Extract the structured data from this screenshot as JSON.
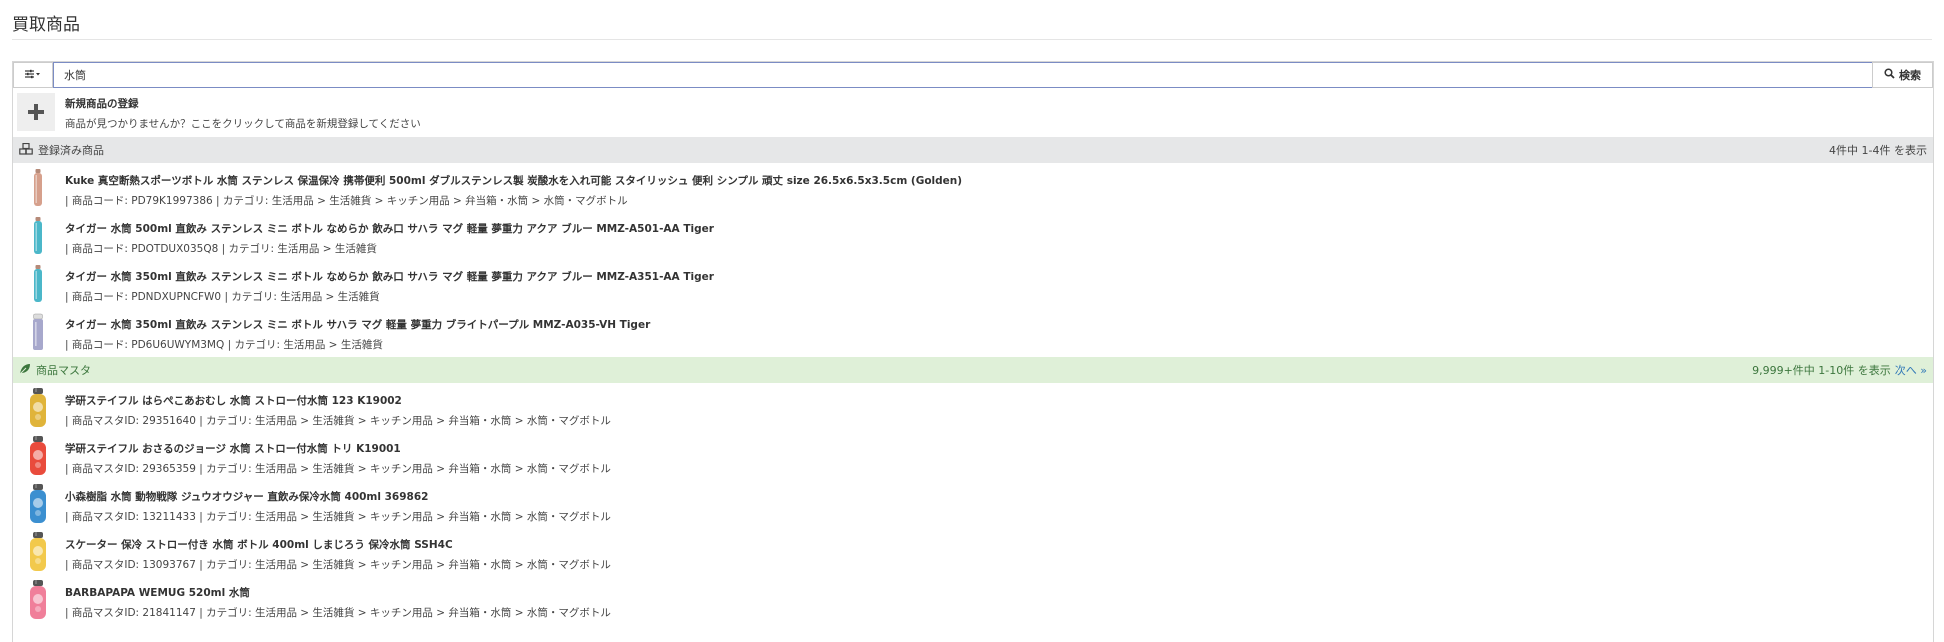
{
  "page": {
    "title": "買取商品"
  },
  "search": {
    "value": "水筒",
    "button_label": "検索"
  },
  "new_product": {
    "title": "新規商品の登録",
    "subtitle": "商品が見つかりませんか？ここをクリックして商品を新規登録してください"
  },
  "registered": {
    "label": "登録済み商品",
    "count_text": "4件中 1-4件 を表示",
    "items": [
      {
        "title": "Kuke 真空断熱スポーツボトル 水筒 ステンレス 保温保冷 携帯便利 500ml ダブルステンレス製 炭酸水を入れ可能 スタイリッシュ 便利 シンプル 頑丈 size 26.5x6.5x3.5cm (Golden)",
        "sub": "| 商品コード: PD79K1997386 | カテゴリ: 生活用品 > 生活雑貨 > キッチン用品 > 弁当箱・水筒 > 水筒・マグボトル",
        "color": "#d6a08c"
      },
      {
        "title": "タイガー 水筒 500ml 直飲み ステンレス ミニ ボトル なめらか 飲み口 サハラ マグ 軽量 夢重力 アクア ブルー MMZ-A501-AA Tiger",
        "sub": "| 商品コード: PDOTDUX035Q8 | カテゴリ: 生活用品 > 生活雑貨",
        "color": "#4bb7c9"
      },
      {
        "title": "タイガー 水筒 350ml 直飲み ステンレス ミニ ボトル なめらか 飲み口 サハラ マグ 軽量 夢重力 アクア ブルー MMZ-A351-AA Tiger",
        "sub": "| 商品コード: PDNDXUPNCFW0 | カテゴリ: 生活用品 > 生活雑貨",
        "color": "#4bb7c9"
      },
      {
        "title": "タイガー 水筒 350ml 直飲み ステンレス ミニ ボトル サハラ マグ 軽量 夢重力 ブライトパープル MMZ-A035-VH Tiger",
        "sub": "| 商品コード: PD6U6UWYM3MQ | カテゴリ: 生活用品 > 生活雑貨",
        "color": "#a7a8cc"
      }
    ]
  },
  "master": {
    "label": "商品マスタ",
    "count_text": "9,999+件中 1-10件 を表示",
    "next_label": "次へ »",
    "items": [
      {
        "title": "学研ステイフル はらぺこあおむし 水筒 ストロー付水筒 123 K19002",
        "sub": "| 商品マスタID: 29351640 | カテゴリ: 生活用品 > 生活雑貨 > キッチン用品 > 弁当箱・水筒 > 水筒・マグボトル",
        "color": "#e0b43a"
      },
      {
        "title": "学研ステイフル おさるのジョージ 水筒 ストロー付水筒 トリ K19001",
        "sub": "| 商品マスタID: 29365359 | カテゴリ: 生活用品 > 生活雑貨 > キッチン用品 > 弁当箱・水筒 > 水筒・マグボトル",
        "color": "#e94b3c"
      },
      {
        "title": "小森樹脂 水筒 動物戦隊 ジュウオウジャー 直飲み保冷水筒 400ml 369862",
        "sub": "| 商品マスタID: 13211433 | カテゴリ: 生活用品 > 生活雑貨 > キッチン用品 > 弁当箱・水筒 > 水筒・マグボトル",
        "color": "#3b8fd0"
      },
      {
        "title": "スケーター 保冷 ストロー付き 水筒 ボトル 400ml しまじろう 保冷水筒 SSH4C",
        "sub": "| 商品マスタID: 13093767 | カテゴリ: 生活用品 > 生活雑貨 > キッチン用品 > 弁当箱・水筒 > 水筒・マグボトル",
        "color": "#f2c94c"
      },
      {
        "title": "BARBAPAPA WEMUG 520ml 水筒",
        "sub": "| 商品マスタID: 21841147 | カテゴリ: 生活用品 > 生活雑貨 > キッチン用品 > 弁当箱・水筒 > 水筒・マグボトル",
        "color": "#f07f9a"
      }
    ]
  }
}
